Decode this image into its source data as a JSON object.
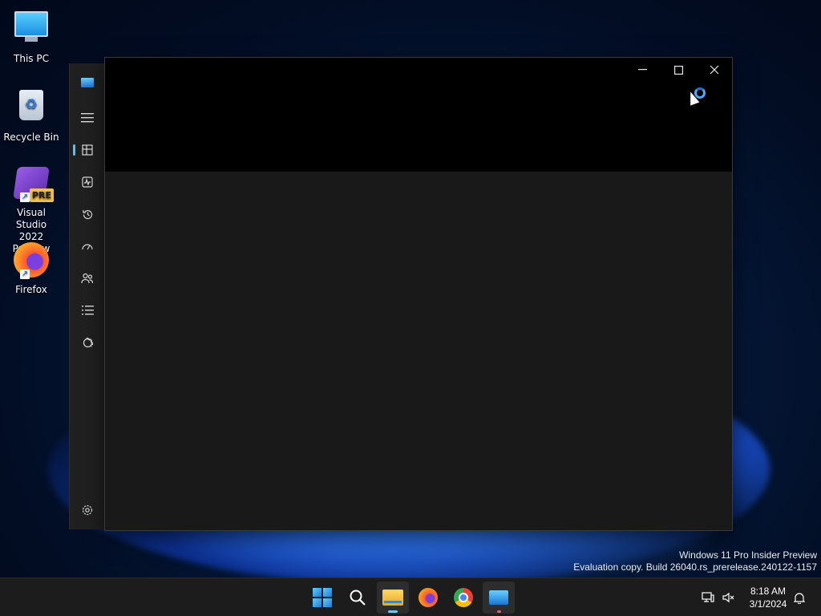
{
  "desktop": {
    "icons": [
      {
        "label": "This PC"
      },
      {
        "label": "Recycle Bin"
      },
      {
        "label": "Visual Studio 2022 Preview",
        "badge": "PRE"
      },
      {
        "label": "Firefox"
      }
    ]
  },
  "app": {
    "sidebar_icons": [
      "app-logo",
      "hamburger-menu-icon",
      "processes-icon",
      "performance-icon",
      "app-history-icon",
      "startup-apps-icon",
      "users-icon",
      "details-icon",
      "services-icon",
      "settings-icon"
    ],
    "window_controls": {
      "minimize": "—",
      "maximize": "☐",
      "close": "✕"
    }
  },
  "watermark": {
    "line1": "Windows 11 Pro Insider Preview",
    "line2": "Evaluation copy. Build 26040.rs_prerelease.240122-1157"
  },
  "taskbar": {
    "time": "8:18 AM",
    "date": "3/1/2024"
  },
  "colors": {
    "accent": "#4cc2ff",
    "window_bg": "#191919",
    "titlebar_bg": "#000000",
    "taskbar_bg": "#1c1c1c"
  }
}
